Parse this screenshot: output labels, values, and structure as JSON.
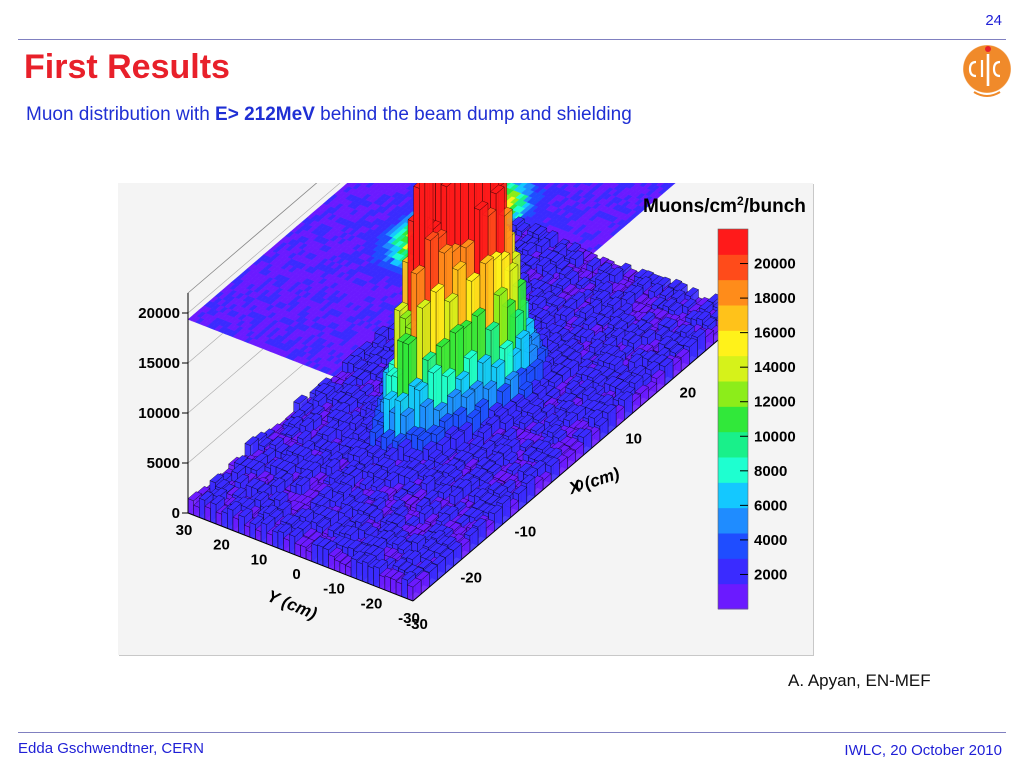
{
  "slide": {
    "page_number": "24",
    "title": "First Results",
    "subtitle_pre": "Muon distribution with ",
    "subtitle_bold": "E> 212MeV",
    "subtitle_post": " behind the beam dump and shielding",
    "credit": "A. Apyan, EN-MEF",
    "footer_left": "Edda Gschwendtner, CERN",
    "footer_right": "IWLC, 20 October 2010",
    "logo_text": "clic"
  },
  "colors": {
    "title": "#e8202a",
    "subtitle": "#1f2fd4",
    "footer": "#1f1fd6",
    "logo": "#f08a2a"
  },
  "chart_data": {
    "type": "lego-3d-histogram",
    "colorbar_title": "Muons/cm",
    "colorbar_title_sup": "2",
    "colorbar_title_post": "/bunch",
    "xlabel": "X (cm)",
    "ylabel": "Y (cm)",
    "x_ticks": [
      "-30",
      "-20",
      "-10",
      "0",
      "10",
      "20"
    ],
    "y_ticks": [
      "30",
      "20",
      "10",
      "0",
      "-10",
      "-20",
      "-30"
    ],
    "z_ticks": [
      "0",
      "5000",
      "10000",
      "15000",
      "20000"
    ],
    "z_tick_values": [
      0,
      5000,
      10000,
      15000,
      20000
    ],
    "colorbar_ticks": [
      "2000",
      "4000",
      "6000",
      "8000",
      "10000",
      "12000",
      "14000",
      "16000",
      "18000",
      "20000"
    ],
    "colorbar_tick_values": [
      2000,
      4000,
      6000,
      8000,
      10000,
      12000,
      14000,
      16000,
      18000,
      20000
    ],
    "xlim": [
      -30,
      30
    ],
    "ylim": [
      -30,
      30
    ],
    "zlim": [
      0,
      22000
    ],
    "background_level": 1500,
    "peaks": [
      {
        "x": -4,
        "y": 3,
        "height": 21000
      },
      {
        "x": 4,
        "y": -1,
        "height": 17000
      },
      {
        "x": 2,
        "y": 1,
        "height": 16000
      }
    ],
    "palette": [
      "#6b1aff",
      "#3a2bff",
      "#1f4dff",
      "#1f8cff",
      "#14c8ff",
      "#1effd0",
      "#19f08a",
      "#31e83a",
      "#8ced1a",
      "#d6f21a",
      "#fff21a",
      "#ffc21a",
      "#ff8c1a",
      "#ff4b1a",
      "#ff1a1a"
    ]
  }
}
